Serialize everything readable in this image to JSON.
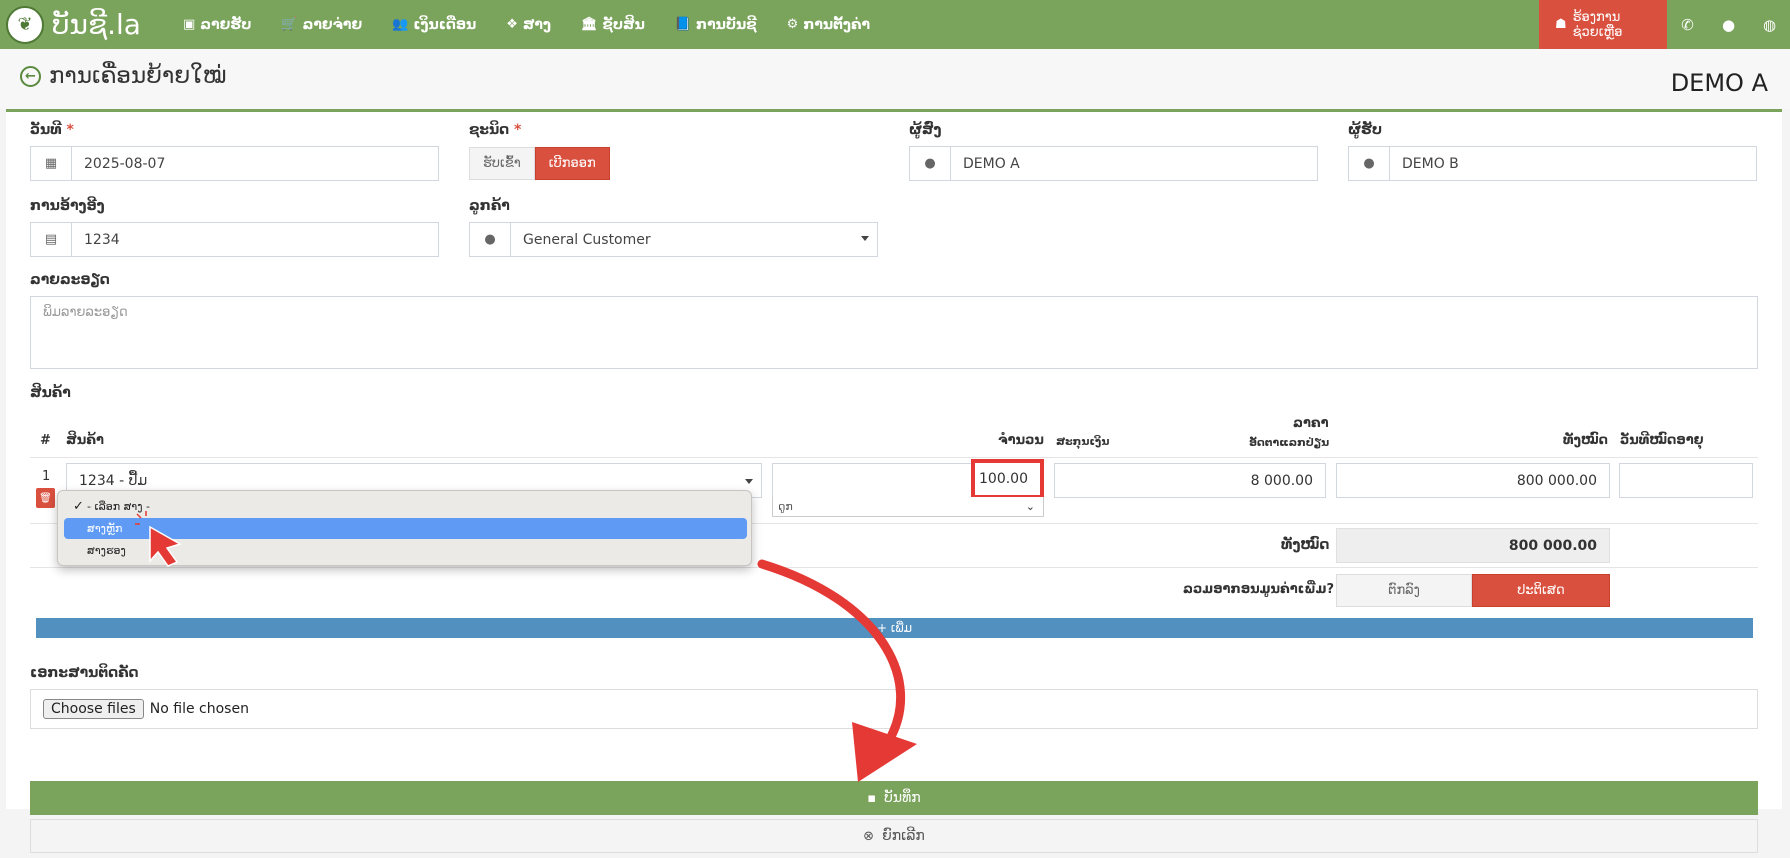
{
  "topbar": {
    "brand": "ບັນຊີ.la",
    "nav": [
      {
        "label": "ລາຍຮັບ",
        "icon": "money-icon",
        "glyph": "▣"
      },
      {
        "label": "ລາຍຈ່າຍ",
        "icon": "cart-icon",
        "glyph": "🛒"
      },
      {
        "label": "ເງິນເດືອນ",
        "icon": "users-icon",
        "glyph": "👥"
      },
      {
        "label": "ສາງ",
        "icon": "cubes-icon",
        "glyph": "❖"
      },
      {
        "label": "ຊັບສິນ",
        "icon": "bank-icon",
        "glyph": "🏛"
      },
      {
        "label": "ການບັນຊີ",
        "icon": "book-icon",
        "glyph": "📘"
      },
      {
        "label": "ການຕັ້ງຄ່າ",
        "icon": "cogs-icon",
        "glyph": "⚙"
      }
    ],
    "help": "ຮ້ອງການຊ່ວຍເຫຼືອ"
  },
  "header": {
    "title": "ການເຄື່ອນຍ້າຍໃໝ່",
    "company": "DEMO A"
  },
  "form": {
    "date_label": "ວັນທີ",
    "date_value": "2025-08-07",
    "type_label": "ຊະນິດ",
    "type_options": [
      "ຮັບເຂົ້າ",
      "ເບີກອອກ"
    ],
    "type_selected": "ເບີກອອກ",
    "sender_label": "ຜູ້ສົ່ງ",
    "sender_value": "DEMO A",
    "receiver_label": "ຜູ້ຮັບ",
    "receiver_value": "DEMO B",
    "reference_label": "ການອ້າງອີງ",
    "reference_value": "1234",
    "customer_label": "ລູກຄ້າ",
    "customer_value": "General Customer",
    "details_label": "ລາຍລະອຽດ",
    "details_placeholder": "ພິມລາຍລະອຽດ",
    "products_label": "ສິນຄ້າ"
  },
  "table": {
    "headers": {
      "num": "#",
      "product": "ສິນຄ້າ",
      "quantity": "ຈຳນວນ",
      "currency": "ສະກຸນເງິນ",
      "price": "ລາຄາ",
      "rate": "ອັດຕາແລກປ່ຽນ",
      "total": "ທັງໝົດ",
      "expiry": "ວັນທີໝົດອາຍຸ"
    },
    "rows": [
      {
        "num": "1",
        "product": "1234 - ປື້ມ",
        "quantity": "100.00",
        "unit": "ດູກ",
        "price": "8 000.00",
        "total": "800 000.00"
      }
    ],
    "grand_total_label": "ທັງໝົດ",
    "grand_total": "800 000.00",
    "vat_label": "ລວມອາກອນມູນຄ່າເພີ່ມ?",
    "vat_options": [
      "ຕົກລົງ",
      "ປະຕິເສດ"
    ],
    "add_label": "+ ເພີ່ມ"
  },
  "dropdown": {
    "options": [
      "- ເລືອກ ສາງ -",
      "ສາງຫຼັກ",
      "ສາງຮອງ"
    ],
    "checked": "- ເລືອກ ສາງ -",
    "highlighted": "ສາງຫຼັກ"
  },
  "attachments": {
    "label": "ເອກະສານຕິດຄັດ",
    "button": "Choose files",
    "status": "No file chosen"
  },
  "actions": {
    "save": "ບັນທຶກ",
    "cancel": "ຍົກເລີກ"
  },
  "colors": {
    "brand": "#7aa35c",
    "danger": "#d9503f",
    "primary": "#5290bf",
    "annotation": "#e53935"
  }
}
